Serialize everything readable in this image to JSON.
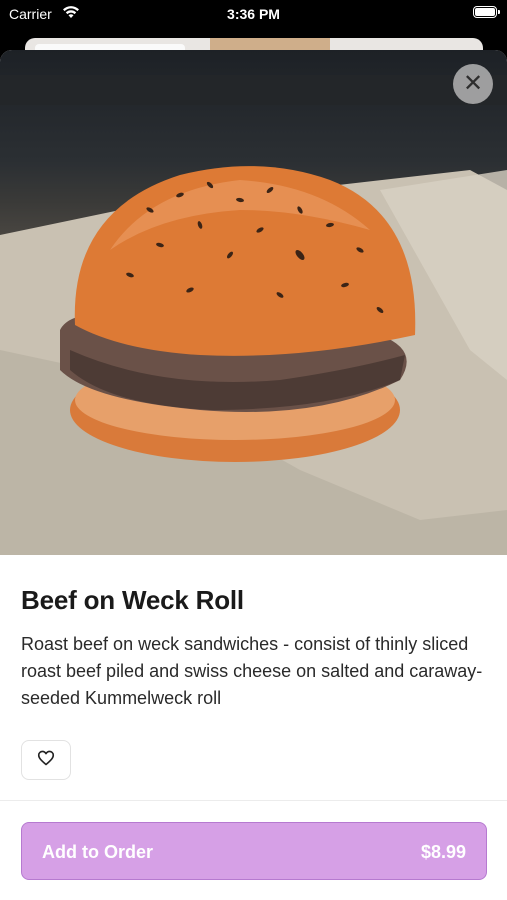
{
  "status_bar": {
    "carrier": "Carrier",
    "time": "3:36 PM",
    "wifi_icon": "wifi-icon",
    "battery_icon": "battery-icon"
  },
  "item": {
    "title": "Beef on Weck Roll",
    "description": "Roast beef on weck sandwiches - consist of thinly sliced roast beef piled and swiss cheese on salted and caraway-seeded Kummelweck roll",
    "image_alt": "Beef on weck sandwich"
  },
  "actions": {
    "close_glyph": "✕",
    "favorite_icon": "heart-icon",
    "add_label": "Add to Order",
    "price": "$8.99"
  },
  "colors": {
    "accent": "#d6a0e6",
    "accent_border": "#b67ad0"
  }
}
